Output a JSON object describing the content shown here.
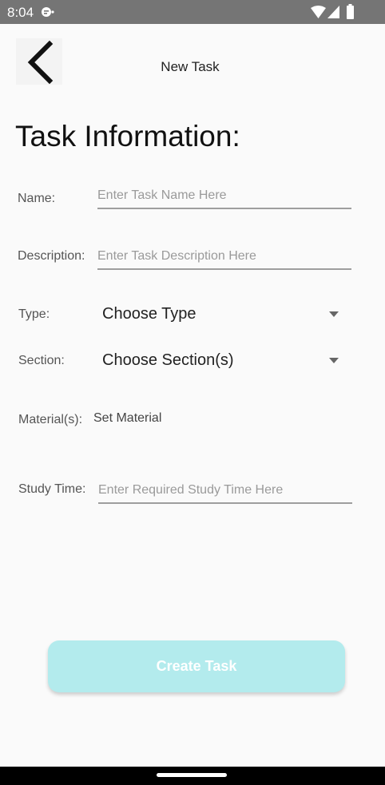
{
  "status_bar": {
    "time": "8:04",
    "icons": [
      "notification-icon",
      "wifi-icon",
      "signal-icon",
      "battery-icon"
    ]
  },
  "header": {
    "back_icon": "chevron-left-icon",
    "title": "New Task"
  },
  "form": {
    "section_title": "Task Information:",
    "name": {
      "label": "Name:",
      "placeholder": "Enter Task Name Here",
      "value": ""
    },
    "description": {
      "label": "Description:",
      "placeholder": "Enter Task Description Here",
      "value": ""
    },
    "type": {
      "label": "Type:",
      "selected": "Choose Type"
    },
    "section": {
      "label": "Section:",
      "selected": "Choose Section(s)"
    },
    "material": {
      "label": "Material(s):",
      "value": "Set Material"
    },
    "study_time": {
      "label": "Study Time:",
      "placeholder": "Enter Required Study Time Here",
      "value": ""
    }
  },
  "actions": {
    "create_label": "Create Task"
  },
  "colors": {
    "status_bar": "#757575",
    "background": "#fafafa",
    "create_button": "#b3ebed",
    "create_button_text": "#ffffff"
  }
}
